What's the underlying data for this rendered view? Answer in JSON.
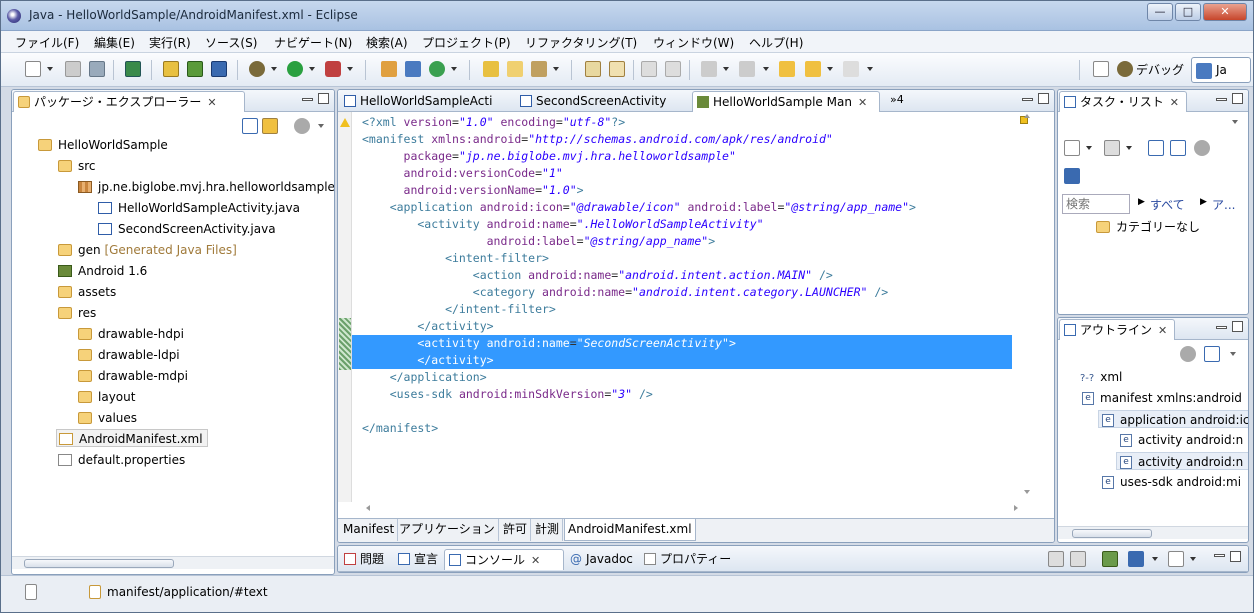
{
  "window": {
    "title": "Java - HelloWorldSample/AndroidManifest.xml - Eclipse"
  },
  "menubar": {
    "items": [
      "ファイル(F)",
      "編集(E)",
      "実行(R)",
      "ソース(S)",
      "ナビゲート(N)",
      "検索(A)",
      "プロジェクト(P)",
      "リファクタリング(T)",
      "ウィンドウ(W)",
      "ヘルプ(H)"
    ]
  },
  "perspectives": {
    "debug": "デバッグ",
    "java": "Ja"
  },
  "package_explorer": {
    "title": "パッケージ・エクスプローラー",
    "project": "HelloWorldSample",
    "src": "src",
    "package": "jp.ne.biglobe.mvj.hra.helloworldsample",
    "file1": "HelloWorldSampleActivity.java",
    "file2": "SecondScreenActivity.java",
    "gen": "gen",
    "gen_note": "[Generated Java Files]",
    "android": "Android 1.6",
    "assets": "assets",
    "res": "res",
    "res_items": [
      "drawable-hdpi",
      "drawable-ldpi",
      "drawable-mdpi",
      "layout",
      "values"
    ],
    "manifest": "AndroidManifest.xml",
    "default_props": "default.properties"
  },
  "editor": {
    "tabs": [
      "HelloWorldSampleActi",
      "SecondScreenActivity",
      "HelloWorldSample Man"
    ],
    "overflow": "»4",
    "lines": [
      [
        [
          "tag",
          "<?xml "
        ],
        [
          "attr",
          "version"
        ],
        [
          "plain",
          "="
        ],
        [
          "val",
          "\"1.0\""
        ],
        [
          "attr",
          " encoding"
        ],
        [
          "plain",
          "="
        ],
        [
          "val",
          "\"utf-8\""
        ],
        [
          "tag",
          "?>"
        ]
      ],
      [
        [
          "tag",
          "<manifest "
        ],
        [
          "attr",
          "xmlns:android"
        ],
        [
          "plain",
          "="
        ],
        [
          "val",
          "\"http://schemas.android.com/apk/res/android\""
        ]
      ],
      [
        [
          "attr",
          "      package"
        ],
        [
          "plain",
          "="
        ],
        [
          "val",
          "\"jp.ne.biglobe.mvj.hra.helloworldsample\""
        ]
      ],
      [
        [
          "attr",
          "      android:versionCode"
        ],
        [
          "plain",
          "="
        ],
        [
          "val",
          "\"1\""
        ]
      ],
      [
        [
          "attr",
          "      android:versionName"
        ],
        [
          "plain",
          "="
        ],
        [
          "val",
          "\"1.0\""
        ],
        [
          "tag",
          ">"
        ]
      ],
      [
        [
          "tag",
          "    <application "
        ],
        [
          "attr",
          "android:icon"
        ],
        [
          "plain",
          "="
        ],
        [
          "val",
          "\"@drawable/icon\""
        ],
        [
          "attr",
          " android:label"
        ],
        [
          "plain",
          "="
        ],
        [
          "val",
          "\"@string/app_name\""
        ],
        [
          "tag",
          ">"
        ]
      ],
      [
        [
          "tag",
          "        <activity "
        ],
        [
          "attr",
          "android:name"
        ],
        [
          "plain",
          "="
        ],
        [
          "val",
          "\".HelloWorldSampleActivity\""
        ]
      ],
      [
        [
          "attr",
          "                  android:label"
        ],
        [
          "plain",
          "="
        ],
        [
          "val",
          "\"@string/app_name\""
        ],
        [
          "tag",
          ">"
        ]
      ],
      [
        [
          "tag",
          "            <intent-filter>"
        ]
      ],
      [
        [
          "tag",
          "                <action "
        ],
        [
          "attr",
          "android:name"
        ],
        [
          "plain",
          "="
        ],
        [
          "val",
          "\"android.intent.action.MAIN\""
        ],
        [
          "tag",
          " />"
        ]
      ],
      [
        [
          "tag",
          "                <category "
        ],
        [
          "attr",
          "android:name"
        ],
        [
          "plain",
          "="
        ],
        [
          "val",
          "\"android.intent.category.LAUNCHER\""
        ],
        [
          "tag",
          " />"
        ]
      ],
      [
        [
          "tag",
          "            </intent-filter>"
        ]
      ],
      [
        [
          "tag",
          "        </activity>"
        ]
      ],
      [
        [
          "tag",
          "        <activity "
        ],
        [
          "attr",
          "android:name"
        ],
        [
          "plain",
          "="
        ],
        [
          "val",
          "\"SecondScreenActivity\""
        ],
        [
          "tag",
          ">"
        ]
      ],
      [
        [
          "tag",
          "        </activity>"
        ]
      ],
      [
        [
          "tag",
          "    </application>"
        ]
      ],
      [
        [
          "tag",
          "    <uses-sdk "
        ],
        [
          "attr",
          "android:minSdkVersion"
        ],
        [
          "plain",
          "="
        ],
        [
          "val",
          "\"3\""
        ],
        [
          "tag",
          " />"
        ]
      ],
      [
        [
          "plain",
          ""
        ]
      ],
      [
        [
          "tag",
          "</manifest>"
        ]
      ]
    ],
    "bottom_tabs": [
      "Manifest",
      "アプリケーション",
      "許可",
      "計測",
      "AndroidManifest.xml"
    ]
  },
  "task_list": {
    "title": "タスク・リスト",
    "search_placeholder": "検索",
    "all": "すべて",
    "activate": "ア...",
    "category": "カテゴリーなし"
  },
  "outline": {
    "title": "アウトライン",
    "items": [
      "xml",
      "manifest xmlns:android",
      "application android:ic",
      "activity android:n",
      "activity android:n",
      "uses-sdk android:mi"
    ]
  },
  "console": {
    "tabs": [
      "問題",
      "宣言",
      "コンソール",
      "Javadoc",
      "プロパティー"
    ]
  },
  "status": {
    "path": "manifest/application/#text"
  }
}
